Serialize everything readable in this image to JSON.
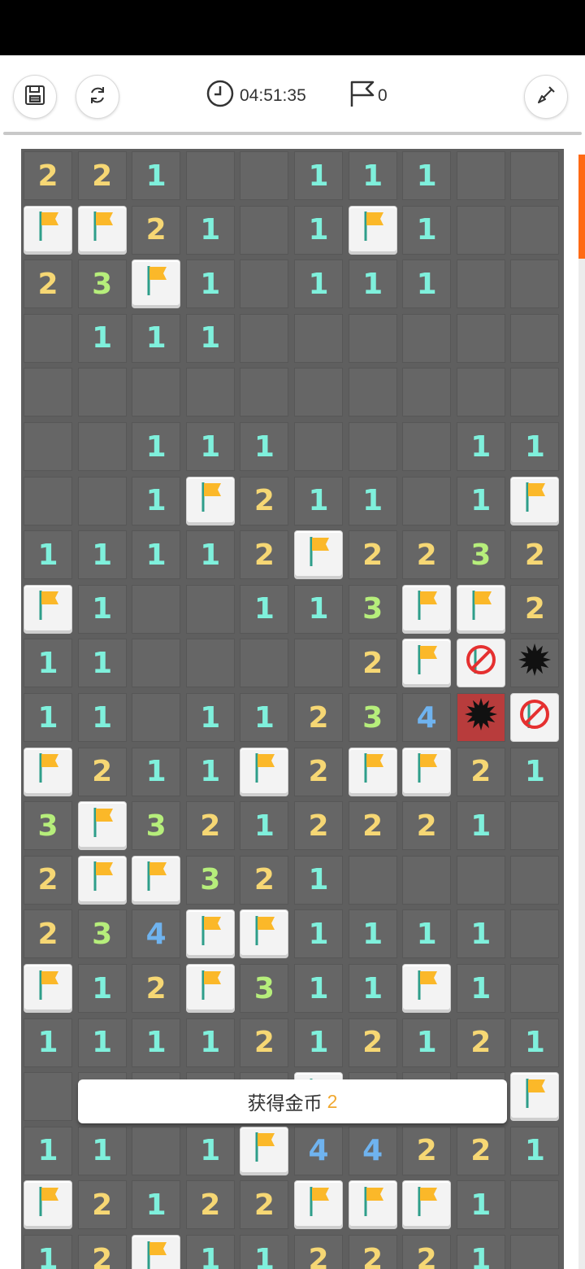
{
  "toolbar": {
    "save_icon": "save-icon",
    "restart_icon": "restart-icon",
    "timer": "04:51:35",
    "flag_count": "0",
    "shovel_icon": "shovel-icon"
  },
  "toast": {
    "text": "获得金币",
    "amount": "2"
  },
  "colors": {
    "accent": "#ff6a14",
    "cell": "#666666",
    "flag": "#fbb829",
    "one": "#7ff0dc",
    "two": "#f6d774",
    "three": "#b6ee7b",
    "four": "#6fb3ef"
  },
  "board": {
    "columns": 10,
    "legend": {
      "e": "empty-revealed",
      "F": "flag",
      "X": "wrong-flag",
      "B": "mine",
      "R": "exploded-mine"
    },
    "rows": [
      [
        "2",
        "2",
        "1",
        "e",
        "e",
        "1",
        "1",
        "1",
        "e",
        "e"
      ],
      [
        "F",
        "F",
        "2",
        "1",
        "e",
        "1",
        "F",
        "1",
        "e",
        "e"
      ],
      [
        "2",
        "3",
        "F",
        "1",
        "e",
        "1",
        "1",
        "1",
        "e",
        "e"
      ],
      [
        "e",
        "1",
        "1",
        "1",
        "e",
        "e",
        "e",
        "e",
        "e",
        "e"
      ],
      [
        "e",
        "e",
        "e",
        "e",
        "e",
        "e",
        "e",
        "e",
        "e",
        "e"
      ],
      [
        "e",
        "e",
        "1",
        "1",
        "1",
        "e",
        "e",
        "e",
        "1",
        "1"
      ],
      [
        "e",
        "e",
        "1",
        "F",
        "2",
        "1",
        "1",
        "e",
        "1",
        "F"
      ],
      [
        "1",
        "1",
        "1",
        "1",
        "2",
        "F",
        "2",
        "2",
        "3",
        "2"
      ],
      [
        "F",
        "1",
        "e",
        "e",
        "1",
        "1",
        "3",
        "F",
        "F",
        "2"
      ],
      [
        "1",
        "1",
        "e",
        "e",
        "e",
        "e",
        "2",
        "F",
        "X",
        "B"
      ],
      [
        "1",
        "1",
        "e",
        "1",
        "1",
        "2",
        "3",
        "4",
        "R",
        "X"
      ],
      [
        "F",
        "2",
        "1",
        "1",
        "F",
        "2",
        "F",
        "F",
        "2",
        "1"
      ],
      [
        "3",
        "F",
        "3",
        "2",
        "1",
        "2",
        "2",
        "2",
        "1",
        "e"
      ],
      [
        "2",
        "F",
        "F",
        "3",
        "2",
        "1",
        "e",
        "e",
        "e",
        "e"
      ],
      [
        "2",
        "3",
        "4",
        "F",
        "F",
        "1",
        "1",
        "1",
        "1",
        "e"
      ],
      [
        "F",
        "1",
        "2",
        "F",
        "3",
        "1",
        "1",
        "F",
        "1",
        "e"
      ],
      [
        "1",
        "1",
        "1",
        "1",
        "2",
        "1",
        "2",
        "1",
        "2",
        "1"
      ],
      [
        "e",
        "e",
        "e",
        "e",
        "e",
        "F",
        "e",
        "e",
        "e",
        "F"
      ],
      [
        "1",
        "1",
        "e",
        "1",
        "F",
        "4",
        "4",
        "2",
        "2",
        "1"
      ],
      [
        "F",
        "2",
        "1",
        "2",
        "2",
        "F",
        "F",
        "F",
        "1",
        "e"
      ],
      [
        "1",
        "2",
        "F",
        "1",
        "1",
        "2",
        "2",
        "2",
        "1",
        "e"
      ]
    ]
  }
}
